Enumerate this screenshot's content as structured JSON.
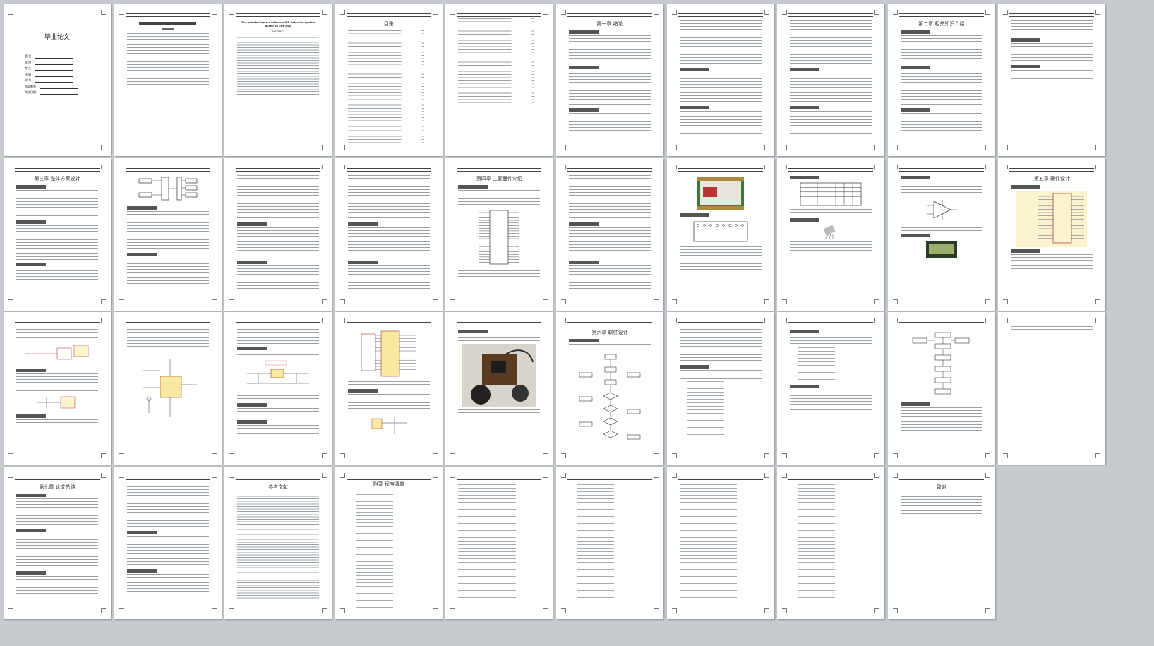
{
  "document": {
    "cover_title": "毕业论文",
    "cover_fields": [
      "题 目",
      "学 院",
      "专 业",
      "班 级",
      "学 号",
      "指导教师",
      "完成日期"
    ],
    "toc_heading": "目录",
    "english_title": "The infinite wireless intercom PIR detection system based on one-chip",
    "english_abstract_heading": "ABSTRACT",
    "pages": [
      {
        "heading": "",
        "kind": "cover"
      },
      {
        "heading": "",
        "kind": "abstract-cn"
      },
      {
        "heading": "",
        "kind": "abstract-en"
      },
      {
        "heading": "目录",
        "kind": "toc"
      },
      {
        "heading": "",
        "kind": "toc2"
      },
      {
        "heading": "第一章 绪论",
        "kind": "text"
      },
      {
        "heading": "",
        "kind": "text"
      },
      {
        "heading": "",
        "kind": "text"
      },
      {
        "heading": "第二章 相关知识介绍",
        "kind": "text"
      },
      {
        "heading": "",
        "kind": "text-short"
      },
      {
        "heading": "第三章 整体方案设计",
        "kind": "text"
      },
      {
        "heading": "",
        "kind": "block-diagram"
      },
      {
        "heading": "",
        "kind": "text"
      },
      {
        "heading": "",
        "kind": "text"
      },
      {
        "heading": "第四章 主要器件介绍",
        "kind": "chip"
      },
      {
        "heading": "",
        "kind": "text"
      },
      {
        "heading": "",
        "kind": "board"
      },
      {
        "heading": "",
        "kind": "table"
      },
      {
        "heading": "",
        "kind": "amp-lcd"
      },
      {
        "heading": "第五章 硬件设计",
        "kind": "schematic"
      },
      {
        "heading": "",
        "kind": "schem-small"
      },
      {
        "heading": "",
        "kind": "schem-ic"
      },
      {
        "heading": "",
        "kind": "schem-power"
      },
      {
        "heading": "",
        "kind": "schem-mcu"
      },
      {
        "heading": "",
        "kind": "photo"
      },
      {
        "heading": "第六章 软件设计",
        "kind": "flow"
      },
      {
        "heading": "",
        "kind": "text-code"
      },
      {
        "heading": "",
        "kind": "text-code2"
      },
      {
        "heading": "",
        "kind": "flow-small"
      },
      {
        "heading": "",
        "kind": "blank"
      },
      {
        "heading": "第七章 论文总结",
        "kind": "text"
      },
      {
        "heading": "",
        "kind": "text"
      },
      {
        "heading": "参考文献",
        "kind": "refs"
      },
      {
        "heading": "附录 程序清单",
        "kind": "code"
      },
      {
        "heading": "",
        "kind": "code"
      },
      {
        "heading": "",
        "kind": "code"
      },
      {
        "heading": "",
        "kind": "code"
      },
      {
        "heading": "",
        "kind": "code"
      },
      {
        "heading": "致谢",
        "kind": "thanks"
      }
    ]
  }
}
